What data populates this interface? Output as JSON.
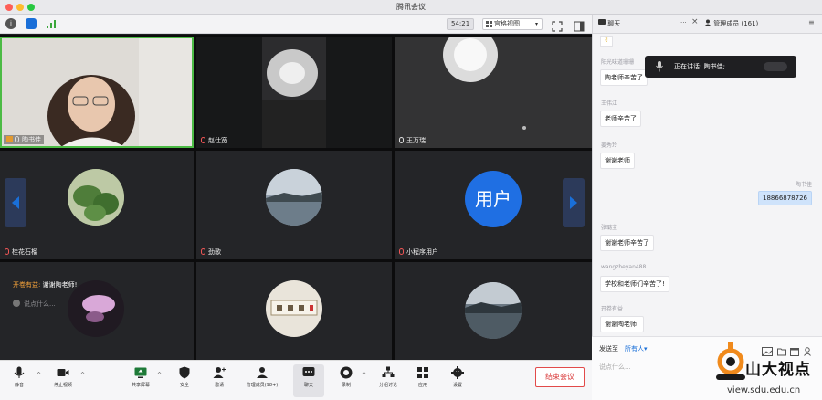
{
  "window": {
    "title": "腾讯会议"
  },
  "topbar": {
    "timer": "54:21",
    "view_mode": "宫格视图"
  },
  "participants": [
    {
      "name": "陶书佳",
      "speaking": true
    },
    {
      "name": "赵仕宽"
    },
    {
      "name": "王万瑞"
    },
    {
      "name": "桂花石榴"
    },
    {
      "name": "劲歌"
    },
    {
      "name": "小程序用户",
      "avatar_text": "用户"
    },
    {
      "name": ""
    },
    {
      "name": ""
    },
    {
      "name": ""
    }
  ],
  "grid_overlay": {
    "prefix": "开卷有益:",
    "text": "谢谢陶老师!",
    "input_placeholder": "说点什么..."
  },
  "toolbar": {
    "mute": "静音",
    "stop_video": "停止视频",
    "share": "共享屏幕",
    "security": "安全",
    "invite": "邀请",
    "members": "管理成员(98+)",
    "chat": "聊天",
    "record": "录制",
    "breakout": "分组讨论",
    "apps": "应用",
    "settings": "设置",
    "end": "结束会议"
  },
  "chat": {
    "tab_chat": "聊天",
    "tab_members": "管理成员 (161)",
    "speaking_label": "正在讲话: 陶书佳;",
    "messages": [
      {
        "sender": "阳光味道珊珊",
        "text": "陶老师辛苦了"
      },
      {
        "sender": "王伟江",
        "text": "老师辛苦了"
      },
      {
        "sender": "姜秀玲",
        "text": "谢谢老师"
      },
      {
        "sender": "陶书佳",
        "text": "18866878726",
        "self": true
      },
      {
        "sender": "张璐宝",
        "text": "谢谢老师辛苦了"
      },
      {
        "sender": "wangzheyan488",
        "text": "学校和老师们辛苦了!"
      },
      {
        "sender": "开卷有益",
        "text": "谢谢陶老师!"
      }
    ],
    "send_to_label": "发送至",
    "send_to_value": "所有人",
    "input_placeholder": "说点什么..."
  },
  "watermark": {
    "brand": "山大视点",
    "url": "view.sdu.edu.cn"
  },
  "colors": {
    "accent": "#0a6cff",
    "end_red": "#d83333",
    "speaking_green": "#4cbb45"
  }
}
